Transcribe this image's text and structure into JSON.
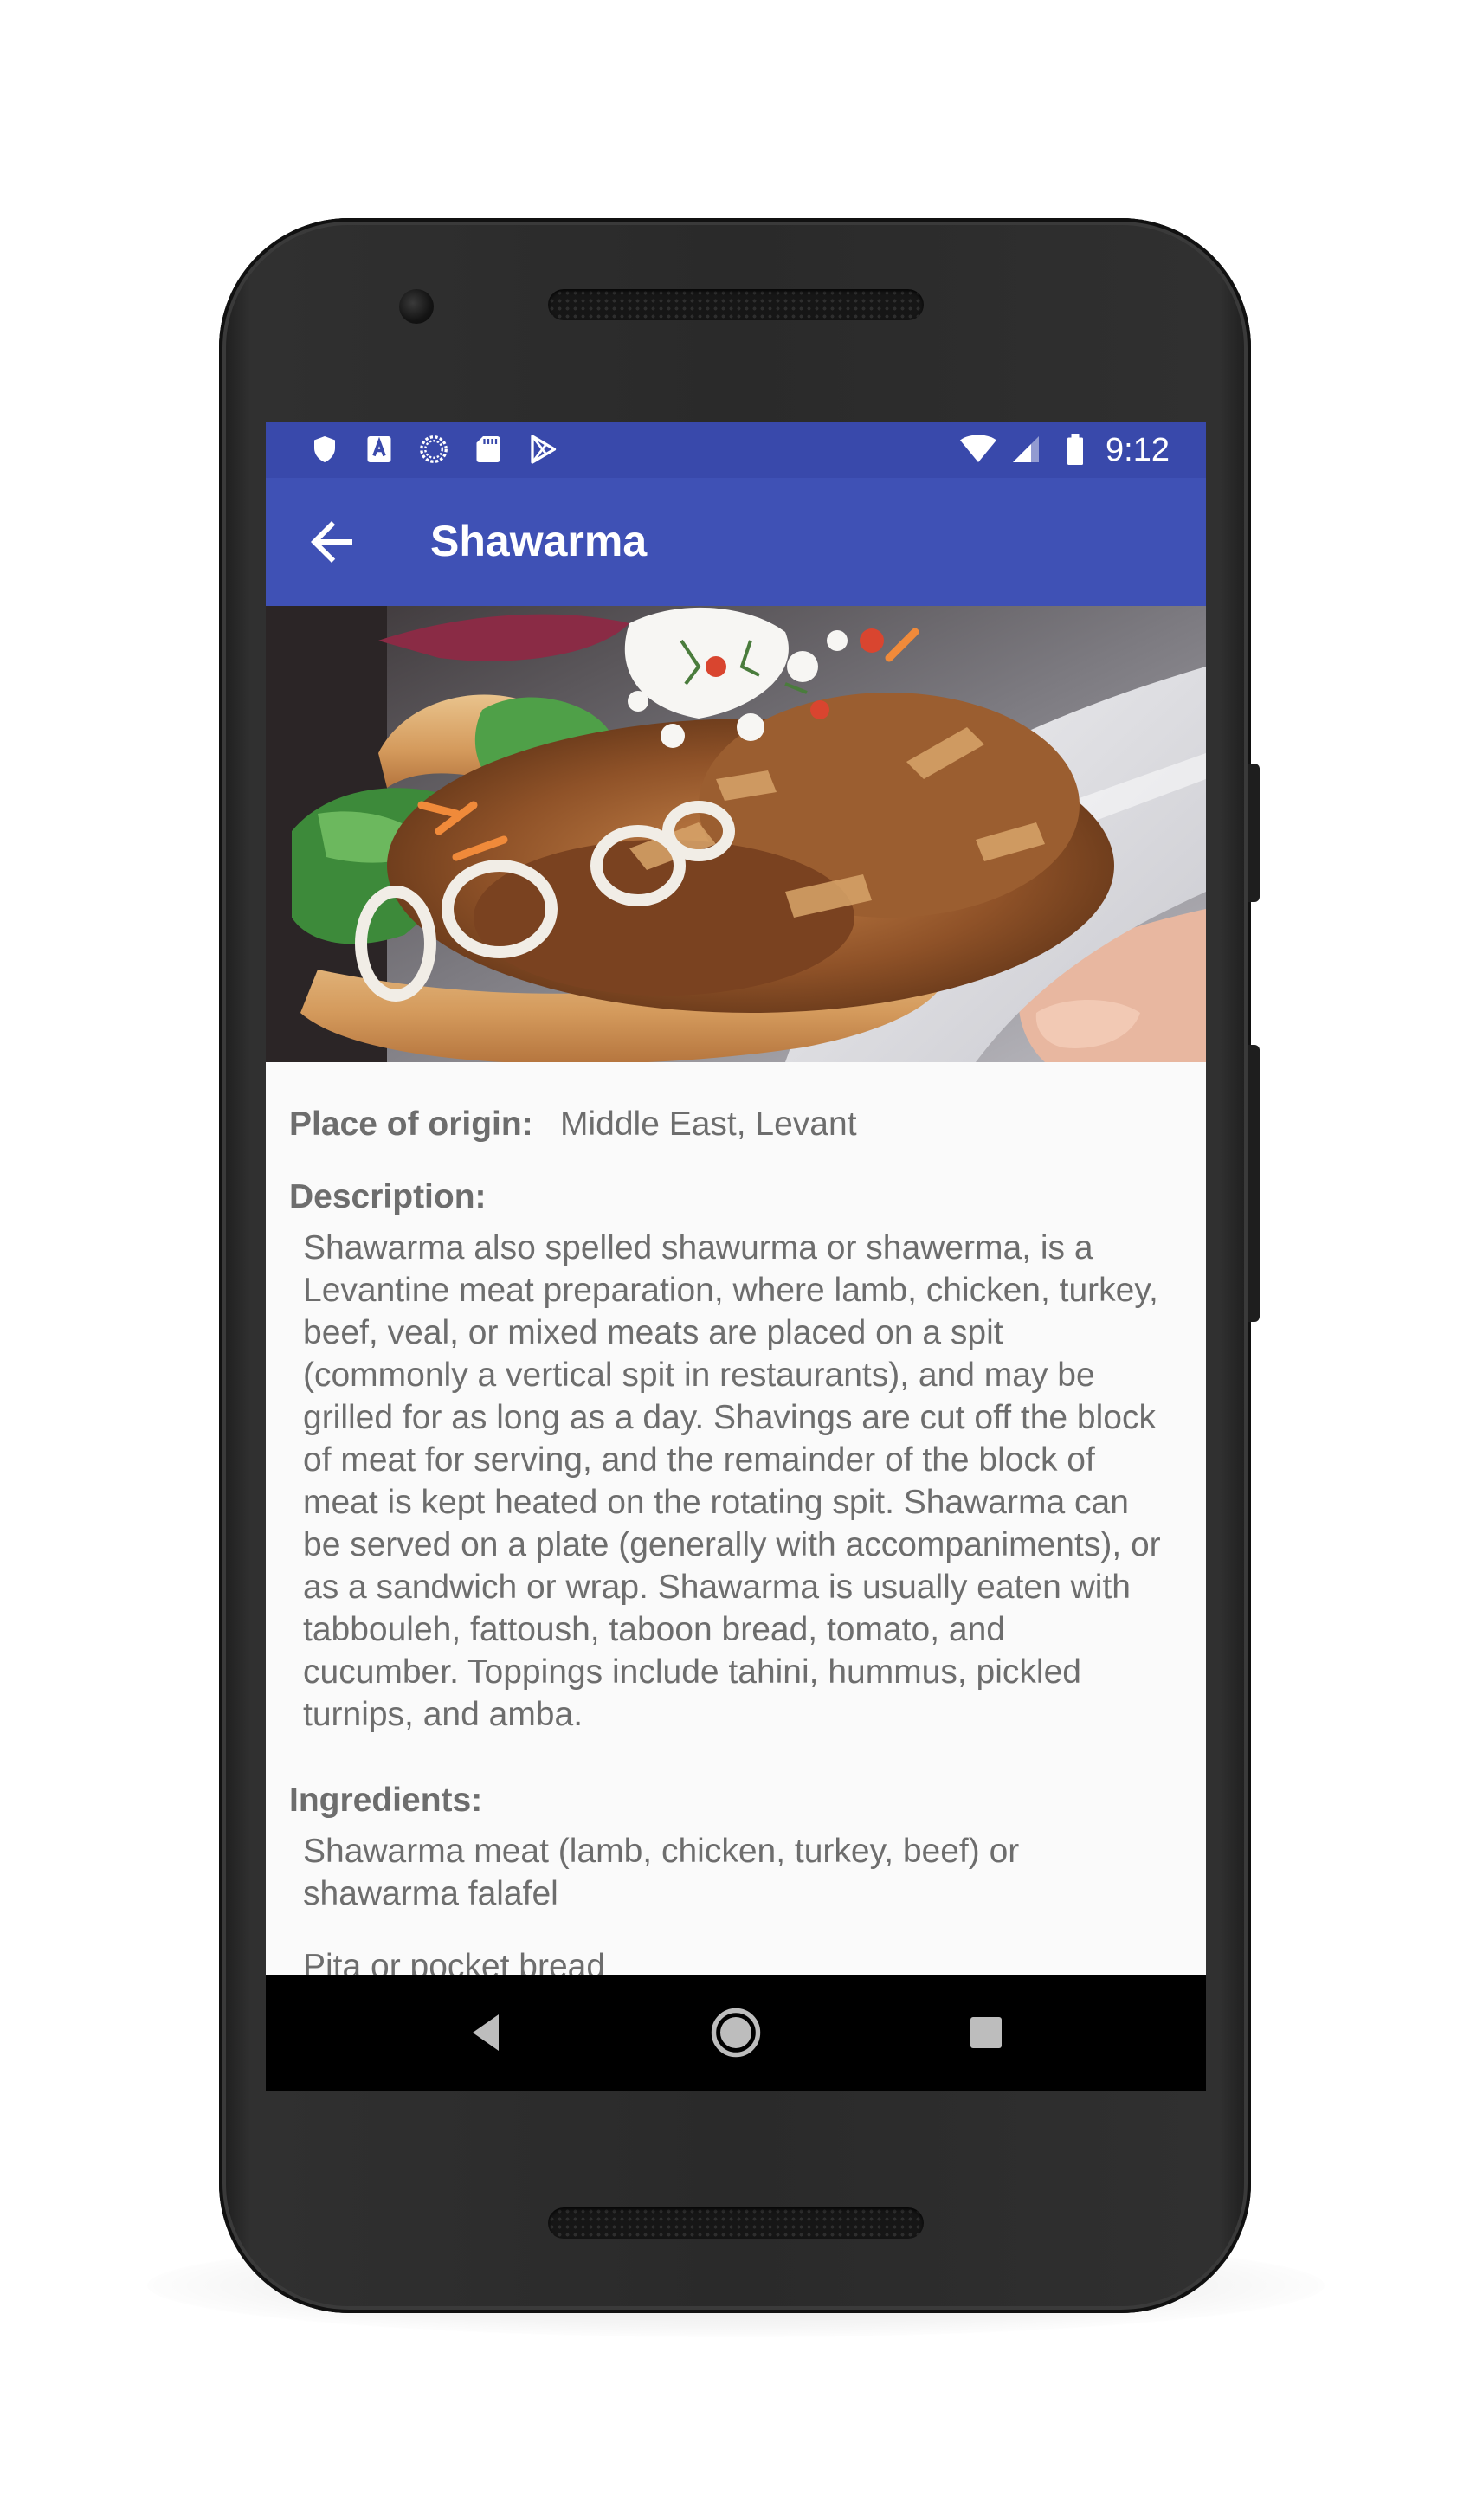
{
  "status_bar": {
    "time": "9:12",
    "left_icons": [
      "shield-icon",
      "a-badge-icon",
      "sync-circle-icon",
      "sd-card-icon",
      "play-store-icon"
    ],
    "right_icons": [
      "wifi-icon",
      "signal-icon",
      "battery-icon"
    ],
    "color": "#3949ab"
  },
  "app_bar": {
    "title": "Shawarma",
    "back_icon": "arrow-back-icon",
    "color": "#3f51b5"
  },
  "hero_image": {
    "subject": "shawarma-sandwich-photo"
  },
  "details": {
    "origin_label": "Place of origin:",
    "origin_value": "Middle East, Levant",
    "description_label": "Description:",
    "description_text": "Shawarma also spelled shawurma or shawerma, is a Levantine meat preparation, where lamb, chicken, turkey, beef, veal, or mixed meats are placed on a spit (commonly a vertical spit in restaurants), and may be grilled for as long as a day. Shavings are cut off the block of meat for serving, and the remainder of the block of meat is kept heated on the rotating spit. Shawarma can be served on a plate (generally with accompaniments), or as a sandwich or wrap. Shawarma is usually eaten with tabbouleh, fattoush, taboon bread, tomato, and cucumber. Toppings include tahini, hummus, pickled turnips, and amba.",
    "ingredients_label": "Ingredients:",
    "ingredients": [
      "Shawarma meat (lamb, chicken, turkey, beef) or shawarma falafel",
      "Pita or pocket bread"
    ]
  },
  "nav_bar": {
    "back_icon": "nav-back-icon",
    "home_icon": "nav-home-icon",
    "recents_icon": "nav-recents-icon"
  }
}
